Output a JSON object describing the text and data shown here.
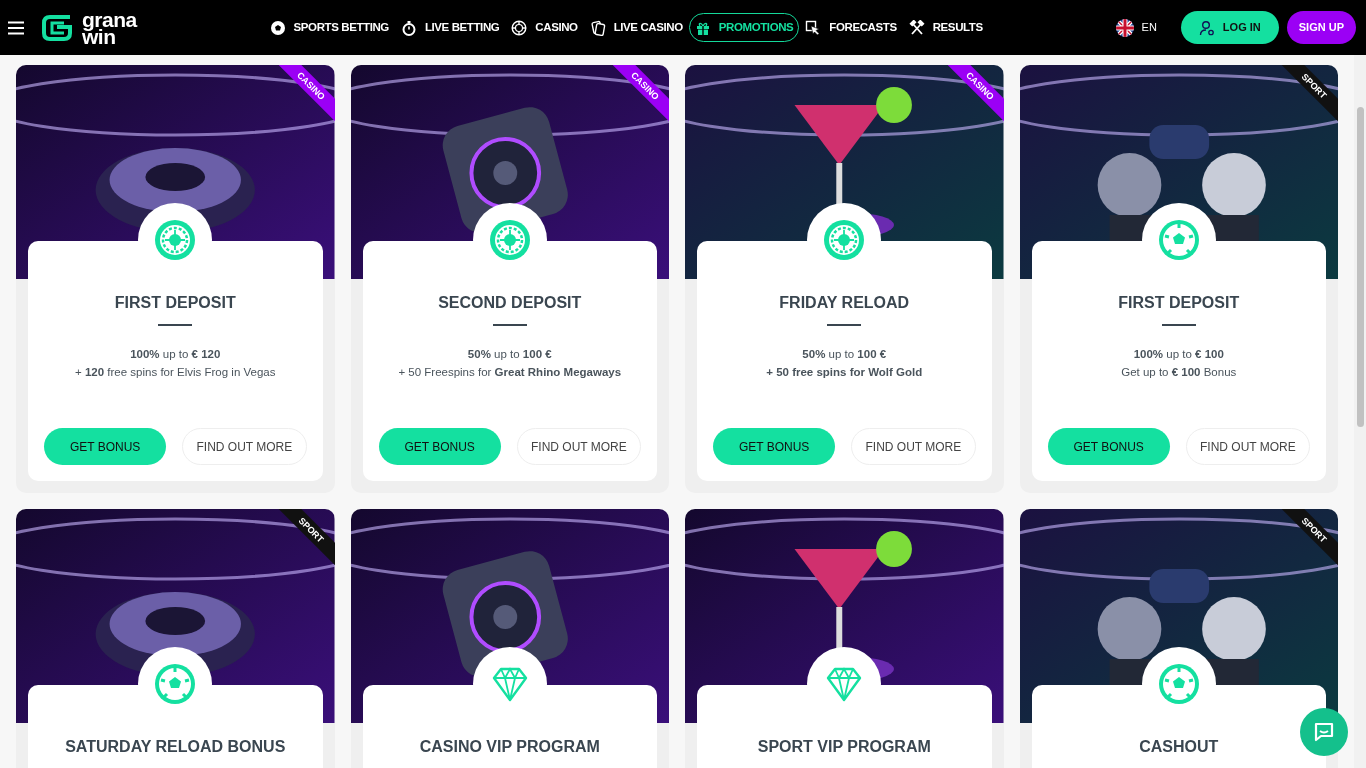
{
  "header": {
    "logo_text": [
      "grana",
      "win"
    ],
    "nav": [
      {
        "label": "SPORTS BETTING",
        "kind": "ball",
        "selected": false
      },
      {
        "label": "LIVE BETTING",
        "kind": "stopwatch",
        "selected": false
      },
      {
        "label": "CASINO",
        "kind": "chip",
        "selected": false
      },
      {
        "label": "LIVE CASINO",
        "kind": "cards",
        "selected": false
      },
      {
        "label": "PROMOTIONS",
        "kind": "gift",
        "selected": true
      },
      {
        "label": "FORECASTS",
        "kind": "pointer",
        "selected": false
      },
      {
        "label": "RESULTS",
        "kind": "hammers",
        "selected": false
      }
    ],
    "language": "EN",
    "login": "LOG IN",
    "signup": "SIGN UP"
  },
  "promotions": [
    {
      "tag": {
        "label": "CASINO",
        "color": "#9b00f5"
      },
      "kind": "roulette",
      "title": "FIRST DEPOSIT",
      "lines": [
        "**100%** up to **€ 120**",
        "+ **120** free spins for Elvis Frog in Vegas"
      ],
      "buttons": [
        "GET BONUS",
        "FIND OUT MORE"
      ]
    },
    {
      "tag": {
        "label": "CASINO",
        "color": "#9b00f5"
      },
      "kind": "roulette",
      "title": "SECOND DEPOSIT",
      "lines": [
        "**50%** up to **100 €**",
        "+ 50 Freespins for **Great Rhino Megaways**"
      ],
      "buttons": [
        "GET BONUS",
        "FIND OUT MORE"
      ]
    },
    {
      "tag": {
        "label": "CASINO",
        "color": "#9b00f5"
      },
      "kind": "roulette",
      "title": "FRIDAY RELOAD",
      "lines": [
        "**50%** up to **100 €**",
        "**+ 50 free spins for Wolf Gold**"
      ],
      "buttons": [
        "GET BONUS",
        "FIND OUT MORE"
      ]
    },
    {
      "tag": {
        "label": "SPORT",
        "color": "#111111"
      },
      "kind": "ball",
      "title": "FIRST DEPOSIT",
      "lines": [
        "**100%** up to **€ 100**",
        "Get up to **€ 100** Bonus"
      ],
      "buttons": [
        "GET BONUS",
        "FIND OUT MORE"
      ]
    },
    {
      "tag": {
        "label": "SPORT",
        "color": "#111111"
      },
      "kind": "ball",
      "title": "SATURDAY RELOAD BONUS"
    },
    {
      "kind": "diamond",
      "title": "CASINO VIP PROGRAM"
    },
    {
      "kind": "diamond",
      "title": "SPORT VIP PROGRAM"
    },
    {
      "tag": {
        "label": "SPORT",
        "color": "#111111"
      },
      "kind": "ball",
      "title": "CASHOUT"
    }
  ]
}
